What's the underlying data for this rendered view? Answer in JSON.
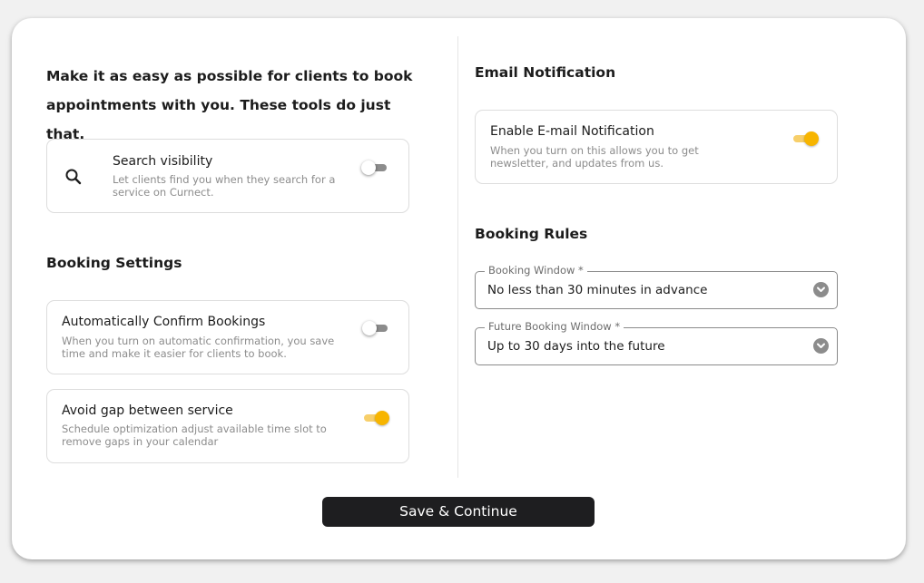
{
  "intro": {
    "heading": "Make it as easy as possible for clients to book appointments with you. These tools do just that."
  },
  "search_visibility": {
    "icon": "search-icon",
    "title": "Search visibility",
    "description": "Let clients find you when they search for a service on Curnect.",
    "enabled": false
  },
  "booking_settings": {
    "title": "Booking Settings",
    "items": [
      {
        "title": "Automatically Confirm Bookings",
        "description": "When you turn on automatic confirmation, you save time and make it easier for clients to book.",
        "enabled": false
      },
      {
        "title": "Avoid gap between service",
        "description": "Schedule optimization adjust available time slot to remove gaps in your calendar",
        "enabled": true
      }
    ]
  },
  "email_notification": {
    "title": "Email Notification",
    "item": {
      "title": "Enable E-mail Notification",
      "description": "When you turn on this allows you to get newsletter, and updates from us.",
      "enabled": true
    }
  },
  "booking_rules": {
    "title": "Booking Rules",
    "booking_window": {
      "label": "Booking Window *",
      "value": "No less than 30 minutes in advance"
    },
    "future_booking_window": {
      "label": "Future Booking Window *",
      "value": "Up to 30 days into the future"
    }
  },
  "actions": {
    "save_label": "Save & Continue"
  },
  "colors": {
    "accent": "#f7b500",
    "accent_track": "#f7cf6a",
    "button_bg": "#1e1e20",
    "muted_text": "#8c8c8c"
  }
}
